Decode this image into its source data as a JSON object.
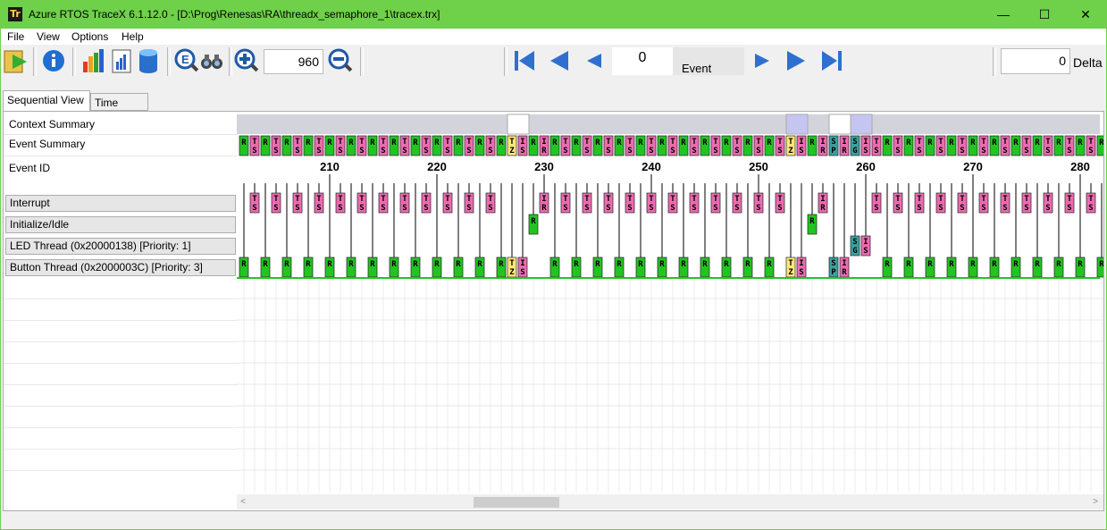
{
  "window": {
    "title": "Azure RTOS TraceX 6.1.12.0 - [D:\\Prog\\Renesas\\RA\\threadx_semaphore_1\\tracex.trx]",
    "app_icon_text": "Tr",
    "minimize_glyph": "—",
    "maximize_glyph": "☐",
    "close_glyph": "✕"
  },
  "menu": {
    "file": "File",
    "view": "View",
    "options": "Options",
    "help": "Help"
  },
  "toolbar": {
    "zoom_value": "960",
    "event_value": "0",
    "event_label": "Event",
    "delta_value": "0",
    "delta_label": "Delta",
    "icons": [
      "open-file-icon",
      "info-icon",
      "bar-chart-icon",
      "report-icon",
      "database-icon",
      "search-event-icon",
      "binoculars-icon",
      "zoom-in-icon",
      "zoom-out-icon",
      "first-event-icon",
      "prev-page-icon",
      "prev-event-icon",
      "next-event-icon",
      "next-page-icon",
      "last-event-icon"
    ],
    "nav_color": "#2f6fd0"
  },
  "tabs": {
    "sequential": "Sequential View",
    "time": "Time View"
  },
  "rows": {
    "context_summary": "Context Summary",
    "event_summary": "Event Summary",
    "event_id": "Event ID",
    "interrupt": "Interrupt",
    "init_idle": "Initialize/Idle",
    "led_thread": "LED Thread (0x20000138) [Priority: 1]",
    "button_thread": "Button Thread (0x2000003C) [Priority: 3]"
  },
  "timeline": {
    "first_event_id": 202,
    "tick_labels": [
      "210",
      "220",
      "230",
      "240",
      "250",
      "260",
      "270",
      "280"
    ],
    "colors": {
      "running": "#22c422",
      "interrupt": "#ec6bb0",
      "sema": "#3aa0a0",
      "yellow": "#ffe87a",
      "context_bar": "#d3d3dc",
      "context_idle": "#ffffff",
      "context_led": "#c5c5f2"
    },
    "context_summary": [
      {
        "from": 202,
        "to": 226,
        "state": "button"
      },
      {
        "from": 227,
        "to": 228,
        "state": "idle"
      },
      {
        "from": 229,
        "to": 252,
        "state": "button"
      },
      {
        "from": 253,
        "to": 254,
        "state": "led"
      },
      {
        "from": 255,
        "to": 256,
        "state": "button"
      },
      {
        "from": 257,
        "to": 258,
        "state": "idle"
      },
      {
        "from": 259,
        "to": 260,
        "state": "led"
      },
      {
        "from": 261,
        "to": 283,
        "state": "button"
      }
    ],
    "events": [
      {
        "id": 202,
        "row": "button",
        "code": "R"
      },
      {
        "id": 203,
        "row": "interrupt",
        "code": "TS"
      },
      {
        "id": 204,
        "row": "button",
        "code": "R"
      },
      {
        "id": 205,
        "row": "interrupt",
        "code": "TS"
      },
      {
        "id": 206,
        "row": "button",
        "code": "R"
      },
      {
        "id": 207,
        "row": "interrupt",
        "code": "TS"
      },
      {
        "id": 208,
        "row": "button",
        "code": "R"
      },
      {
        "id": 209,
        "row": "interrupt",
        "code": "TS"
      },
      {
        "id": 210,
        "row": "button",
        "code": "R"
      },
      {
        "id": 211,
        "row": "interrupt",
        "code": "TS"
      },
      {
        "id": 212,
        "row": "button",
        "code": "R"
      },
      {
        "id": 213,
        "row": "interrupt",
        "code": "TS"
      },
      {
        "id": 214,
        "row": "button",
        "code": "R"
      },
      {
        "id": 215,
        "row": "interrupt",
        "code": "TS"
      },
      {
        "id": 216,
        "row": "button",
        "code": "R"
      },
      {
        "id": 217,
        "row": "interrupt",
        "code": "TS"
      },
      {
        "id": 218,
        "row": "button",
        "code": "R"
      },
      {
        "id": 219,
        "row": "interrupt",
        "code": "TS"
      },
      {
        "id": 220,
        "row": "button",
        "code": "R"
      },
      {
        "id": 221,
        "row": "interrupt",
        "code": "TS"
      },
      {
        "id": 222,
        "row": "button",
        "code": "R"
      },
      {
        "id": 223,
        "row": "interrupt",
        "code": "TS"
      },
      {
        "id": 224,
        "row": "button",
        "code": "R"
      },
      {
        "id": 225,
        "row": "interrupt",
        "code": "TS"
      },
      {
        "id": 226,
        "row": "button",
        "code": "R"
      },
      {
        "id": 227,
        "row": "button",
        "code": "TZ"
      },
      {
        "id": 228,
        "row": "button",
        "code": "IS"
      },
      {
        "id": 229,
        "row": "idle",
        "code": "R"
      },
      {
        "id": 230,
        "row": "interrupt",
        "code": "IR"
      },
      {
        "id": 231,
        "row": "button",
        "code": "R"
      },
      {
        "id": 232,
        "row": "interrupt",
        "code": "TS"
      },
      {
        "id": 233,
        "row": "button",
        "code": "R"
      },
      {
        "id": 234,
        "row": "interrupt",
        "code": "TS"
      },
      {
        "id": 235,
        "row": "button",
        "code": "R"
      },
      {
        "id": 236,
        "row": "interrupt",
        "code": "TS"
      },
      {
        "id": 237,
        "row": "button",
        "code": "R"
      },
      {
        "id": 238,
        "row": "interrupt",
        "code": "TS"
      },
      {
        "id": 239,
        "row": "button",
        "code": "R"
      },
      {
        "id": 240,
        "row": "interrupt",
        "code": "TS"
      },
      {
        "id": 241,
        "row": "button",
        "code": "R"
      },
      {
        "id": 242,
        "row": "interrupt",
        "code": "TS"
      },
      {
        "id": 243,
        "row": "button",
        "code": "R"
      },
      {
        "id": 244,
        "row": "interrupt",
        "code": "TS"
      },
      {
        "id": 245,
        "row": "button",
        "code": "R"
      },
      {
        "id": 246,
        "row": "interrupt",
        "code": "TS"
      },
      {
        "id": 247,
        "row": "button",
        "code": "R"
      },
      {
        "id": 248,
        "row": "interrupt",
        "code": "TS"
      },
      {
        "id": 249,
        "row": "button",
        "code": "R"
      },
      {
        "id": 250,
        "row": "interrupt",
        "code": "TS"
      },
      {
        "id": 251,
        "row": "button",
        "code": "R"
      },
      {
        "id": 252,
        "row": "interrupt",
        "code": "TS"
      },
      {
        "id": 253,
        "row": "button",
        "code": "TZ"
      },
      {
        "id": 254,
        "row": "button",
        "code": "IS"
      },
      {
        "id": 255,
        "row": "idle",
        "code": "R"
      },
      {
        "id": 256,
        "row": "interrupt",
        "code": "IR"
      },
      {
        "id": 257,
        "row": "button",
        "code": "SP"
      },
      {
        "id": 258,
        "row": "button",
        "code": "IR"
      },
      {
        "id": 259,
        "row": "led",
        "code": "SG"
      },
      {
        "id": 260,
        "row": "led",
        "code": "IS"
      },
      {
        "id": 261,
        "row": "interrupt",
        "code": "TS"
      },
      {
        "id": 262,
        "row": "button",
        "code": "R"
      },
      {
        "id": 263,
        "row": "interrupt",
        "code": "TS"
      },
      {
        "id": 264,
        "row": "button",
        "code": "R"
      },
      {
        "id": 265,
        "row": "interrupt",
        "code": "TS"
      },
      {
        "id": 266,
        "row": "button",
        "code": "R"
      },
      {
        "id": 267,
        "row": "interrupt",
        "code": "TS"
      },
      {
        "id": 268,
        "row": "button",
        "code": "R"
      },
      {
        "id": 269,
        "row": "interrupt",
        "code": "TS"
      },
      {
        "id": 270,
        "row": "button",
        "code": "R"
      },
      {
        "id": 271,
        "row": "interrupt",
        "code": "TS"
      },
      {
        "id": 272,
        "row": "button",
        "code": "R"
      },
      {
        "id": 273,
        "row": "interrupt",
        "code": "TS"
      },
      {
        "id": 274,
        "row": "button",
        "code": "R"
      },
      {
        "id": 275,
        "row": "interrupt",
        "code": "TS"
      },
      {
        "id": 276,
        "row": "button",
        "code": "R"
      },
      {
        "id": 277,
        "row": "interrupt",
        "code": "TS"
      },
      {
        "id": 278,
        "row": "button",
        "code": "R"
      },
      {
        "id": 279,
        "row": "interrupt",
        "code": "TS"
      },
      {
        "id": 280,
        "row": "button",
        "code": "R"
      },
      {
        "id": 281,
        "row": "interrupt",
        "code": "TS"
      },
      {
        "id": 282,
        "row": "button",
        "code": "R"
      },
      {
        "id": 283,
        "row": "interrupt",
        "code": "TS"
      }
    ]
  }
}
